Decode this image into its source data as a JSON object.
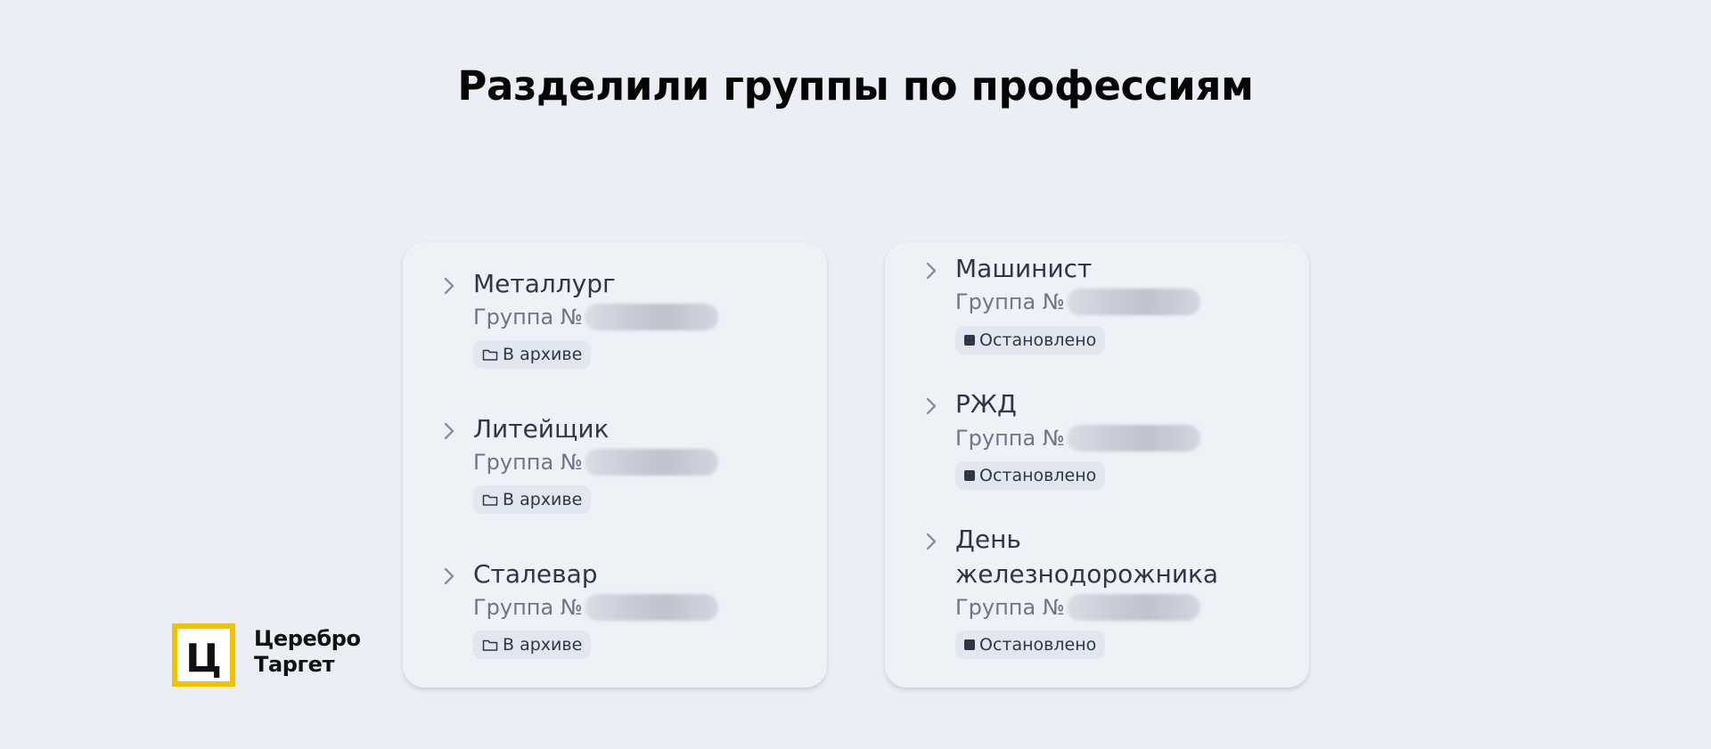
{
  "page": {
    "title": "Разделили группы по профессиям"
  },
  "colors": {
    "background": "#ebeef5",
    "card": "#eef1f6",
    "badge": "#e1e6ef",
    "logo_accent": "#f2c200"
  },
  "left_panel": {
    "items": [
      {
        "title": "Металлург",
        "group_label": "Группа №",
        "status": "В архиве",
        "status_icon": "folder-icon"
      },
      {
        "title": "Литейщик",
        "group_label": "Группа №",
        "status": "В архиве",
        "status_icon": "folder-icon"
      },
      {
        "title": "Сталевар",
        "group_label": "Группа №",
        "status": "В архиве",
        "status_icon": "folder-icon"
      }
    ]
  },
  "right_panel": {
    "items": [
      {
        "title": "Машинист",
        "group_label": "Группа №",
        "status": "Остановлено",
        "status_icon": "stop-icon"
      },
      {
        "title": "РЖД",
        "group_label": "Группа №",
        "status": "Остановлено",
        "status_icon": "stop-icon"
      },
      {
        "title_line1": "День",
        "title_line2": "железнодорожника",
        "group_label": "Группа №",
        "status": "Остановлено",
        "status_icon": "stop-icon"
      }
    ]
  },
  "brand": {
    "logo_letter": "Ц",
    "name_line1": "Церебро",
    "name_line2": "Таргет"
  },
  "icons": {
    "expand": "chevron-right-icon",
    "archived": "folder-icon",
    "stopped": "stop-icon"
  }
}
